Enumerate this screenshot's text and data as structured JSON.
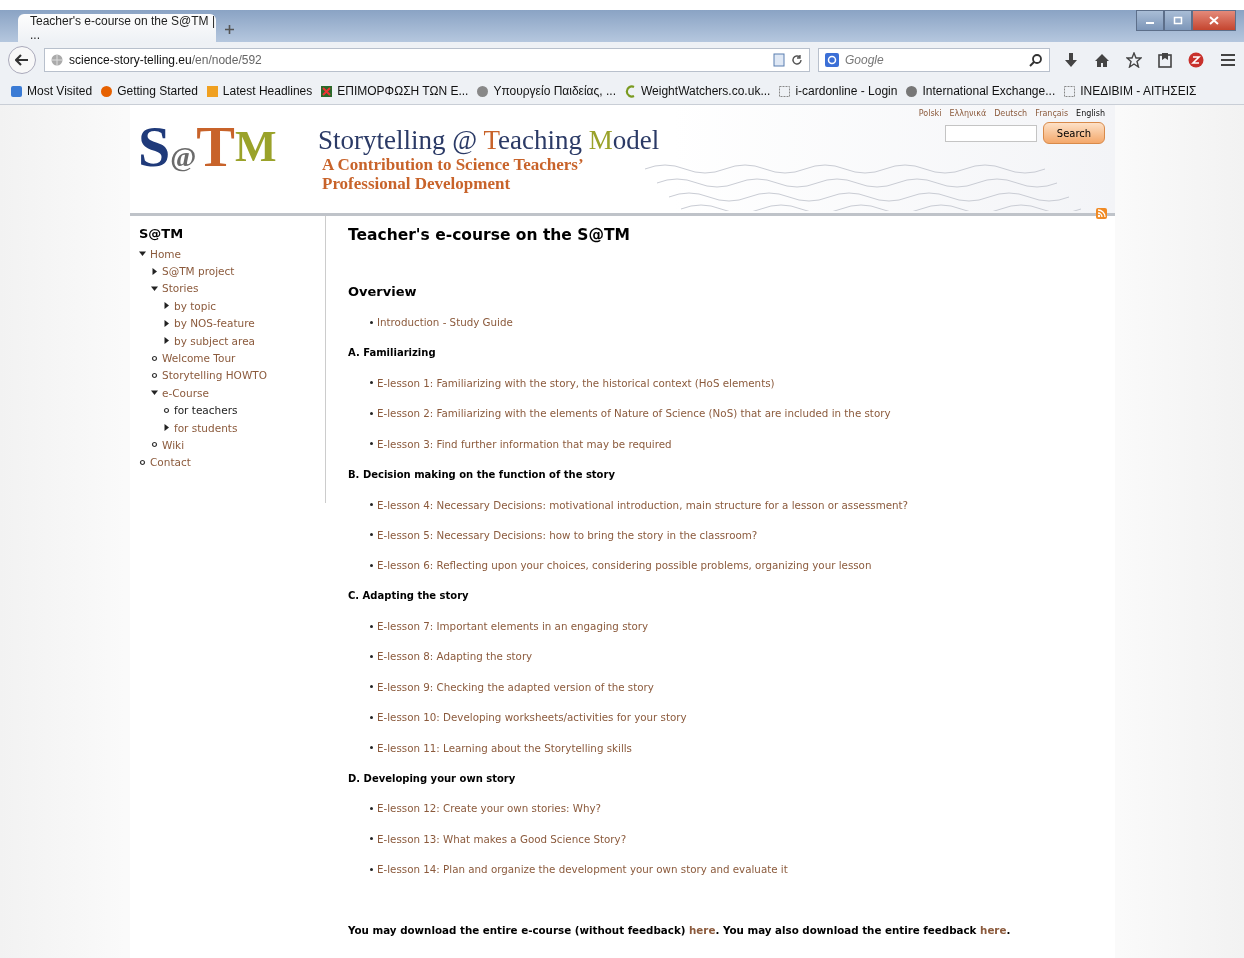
{
  "browser": {
    "tab_title": "Teacher's e-course on the S@TM | ...",
    "url_host": "science-story-telling.eu",
    "url_path": "/en/node/592",
    "search_placeholder": "Google",
    "bookmarks": [
      {
        "label": "Most Visited"
      },
      {
        "label": "Getting Started"
      },
      {
        "label": "Latest Headlines"
      },
      {
        "label": "ΕΠΙΜΟΡΦΩΣΗ ΤΩΝ Ε..."
      },
      {
        "label": "Υπουργείο Παιδείας, ..."
      },
      {
        "label": "WeightWatchers.co.uk..."
      },
      {
        "label": "i-cardonline - Login"
      },
      {
        "label": "International Exchange..."
      },
      {
        "label": "ΙΝΕΔΙΒΙΜ - ΑΙΤΗΣΕΙΣ"
      }
    ]
  },
  "header": {
    "logo": [
      {
        "text": "S",
        "color": "#1f3a7a"
      },
      {
        "text": "@",
        "color": "#6b6b6b"
      },
      {
        "text": "T",
        "color": "#c8632a"
      },
      {
        "text": "M",
        "color": "#9aa22a"
      }
    ],
    "title": [
      {
        "text": "Storytelling @ ",
        "color": "#2b3a66"
      },
      {
        "text": "T",
        "color": "#c8632a"
      },
      {
        "text": "eaching ",
        "color": "#2b3a66"
      },
      {
        "text": "M",
        "color": "#9aa22a"
      },
      {
        "text": "odel",
        "color": "#2b3a66"
      }
    ],
    "subtitle": [
      "A Contribution to Science Teachers’",
      "Professional Development"
    ],
    "languages": [
      {
        "label": "Polski",
        "selected": false
      },
      {
        "label": "Ελληνικά",
        "selected": false
      },
      {
        "label": "Deutsch",
        "selected": false
      },
      {
        "label": "Français",
        "selected": false
      },
      {
        "label": "English",
        "selected": true
      }
    ],
    "search_button": "Search"
  },
  "sidebar": {
    "title": "S@TM",
    "items": [
      {
        "label": "Home",
        "kind": "folder",
        "expanded": true,
        "selected": false,
        "children": [
          {
            "label": "S@TM project",
            "kind": "folder",
            "expanded": false,
            "selected": false
          },
          {
            "label": "Stories",
            "kind": "folder",
            "expanded": true,
            "selected": false,
            "children": [
              {
                "label": "by topic",
                "kind": "folder",
                "expanded": false,
                "selected": false
              },
              {
                "label": "by NOS-feature",
                "kind": "folder",
                "expanded": false,
                "selected": false
              },
              {
                "label": "by subject area",
                "kind": "folder",
                "expanded": false,
                "selected": false
              }
            ]
          },
          {
            "label": "Welcome Tour",
            "kind": "leaf",
            "selected": false
          },
          {
            "label": "Storytelling HOWTO",
            "kind": "leaf",
            "selected": false
          },
          {
            "label": "e-Course",
            "kind": "folder",
            "expanded": true,
            "selected": false,
            "children": [
              {
                "label": "for teachers",
                "kind": "leaf",
                "selected": true
              },
              {
                "label": "for students",
                "kind": "folder",
                "expanded": false,
                "selected": false
              }
            ]
          },
          {
            "label": "Wiki",
            "kind": "leaf",
            "selected": false
          }
        ]
      },
      {
        "label": "Contact",
        "kind": "leaf",
        "selected": false
      }
    ]
  },
  "content": {
    "title": "Teacher's e-course on the S@TM",
    "subtitle": "Overview",
    "sections": [
      {
        "items": [
          "Introduction - Study Guide"
        ]
      },
      {
        "heading": "A. Familiarizing",
        "items": [
          "E-lesson 1: Familiarizing with the story, the historical context (HoS elements)",
          "E-lesson 2: Familiarizing with the elements of Nature of Science (NoS) that are included in the story",
          "E-lesson 3: Find further information that may be required"
        ]
      },
      {
        "heading": "B. Decision making on the function of the story",
        "items": [
          "E-lesson 4: Necessary Decisions: motivational introduction, main structure for a lesson or assessment?",
          "E-lesson 5: Necessary Decisions: how to bring the story in the classroom?",
          "E-lesson 6: Reflecting upon your choices, considering possible problems, organizing your lesson"
        ]
      },
      {
        "heading": "C. Adapting the story",
        "items": [
          "E-lesson 7: Important elements in an engaging story",
          "E-lesson 8: Adapting the story",
          "E-lesson 9: Checking the adapted version of the story",
          "E-lesson 10: Developing worksheets/activities for your story",
          "E-lesson 11: Learning about the Storytelling skills"
        ]
      },
      {
        "heading": "D. Developing your own story",
        "items": [
          "E-lesson 12: Create your own stories: Why?",
          "E-lesson 13: What makes a Good Science Story?",
          "E-lesson 14: Plan and organize the development your own story and evaluate it"
        ]
      }
    ],
    "footer": [
      {
        "kind": "text",
        "text": "You may download the entire e-course (without feedback) "
      },
      {
        "kind": "link",
        "text": "here"
      },
      {
        "kind": "text",
        "text": ". You may also download the entire feedback "
      },
      {
        "kind": "link",
        "text": "here"
      },
      {
        "kind": "text",
        "text": "."
      }
    ]
  }
}
